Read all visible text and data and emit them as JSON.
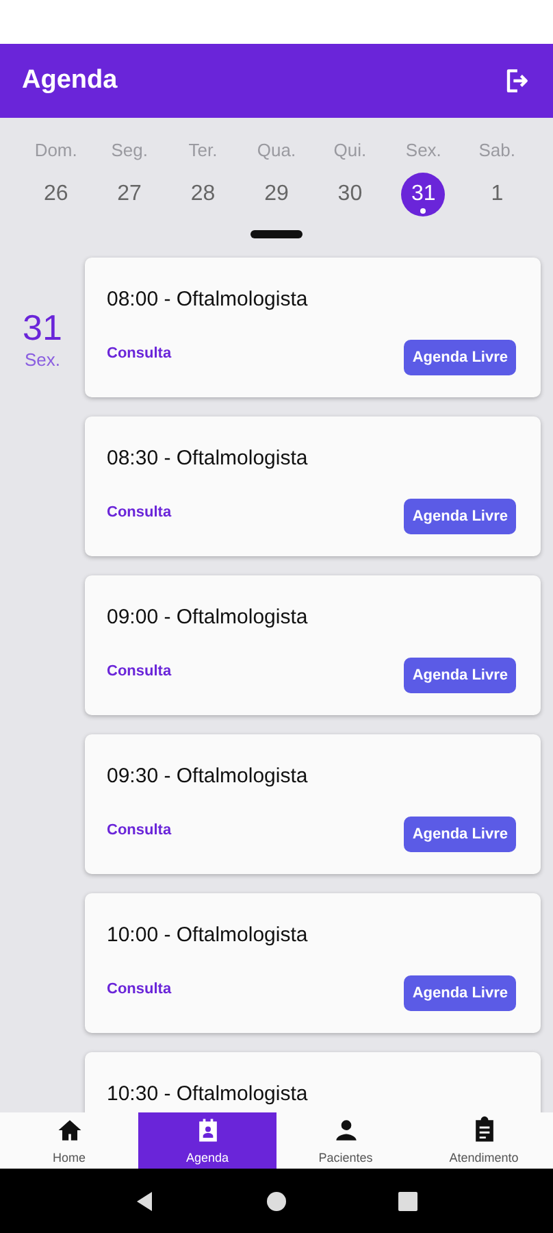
{
  "header": {
    "title": "Agenda"
  },
  "week": [
    {
      "weekday": "Dom.",
      "day": "26",
      "selected": false
    },
    {
      "weekday": "Seg.",
      "day": "27",
      "selected": false
    },
    {
      "weekday": "Ter.",
      "day": "28",
      "selected": false
    },
    {
      "weekday": "Qua.",
      "day": "29",
      "selected": false
    },
    {
      "weekday": "Qui.",
      "day": "30",
      "selected": false
    },
    {
      "weekday": "Sex.",
      "day": "31",
      "selected": true
    },
    {
      "weekday": "Sab.",
      "day": "1",
      "selected": false
    }
  ],
  "current_date": {
    "day": "31",
    "weekday": "Sex."
  },
  "appointments": [
    {
      "title": "08:00 - Oftalmologista",
      "type": "Consulta",
      "status": "Agenda Livre"
    },
    {
      "title": "08:30 - Oftalmologista",
      "type": "Consulta",
      "status": "Agenda Livre"
    },
    {
      "title": "09:00 - Oftalmologista",
      "type": "Consulta",
      "status": "Agenda Livre"
    },
    {
      "title": "09:30 - Oftalmologista",
      "type": "Consulta",
      "status": "Agenda Livre"
    },
    {
      "title": "10:00 - Oftalmologista",
      "type": "Consulta",
      "status": "Agenda Livre"
    },
    {
      "title": "10:30 - Oftalmologista"
    }
  ],
  "nav": [
    {
      "label": "Home",
      "selected": false
    },
    {
      "label": "Agenda",
      "selected": true
    },
    {
      "label": "Pacientes",
      "selected": false
    },
    {
      "label": "Atendimento",
      "selected": false
    }
  ]
}
